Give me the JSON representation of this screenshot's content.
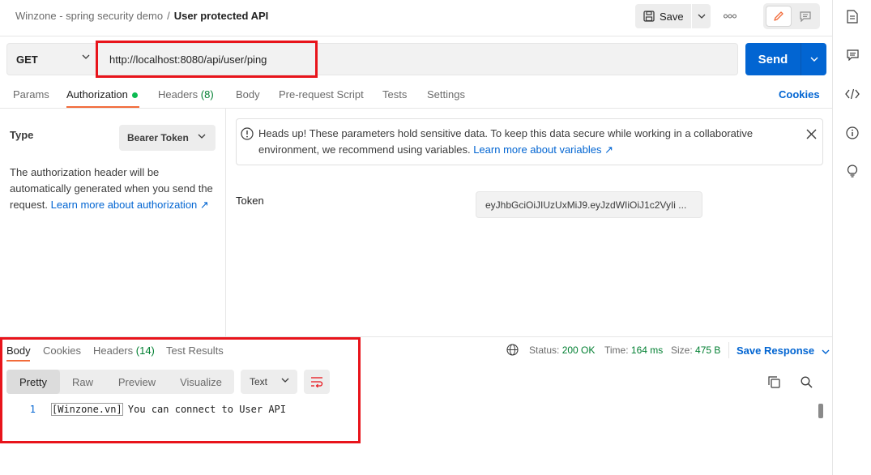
{
  "breadcrumb": {
    "workspace": "Winzone - spring security demo",
    "separator": "/",
    "request_name": "User protected API"
  },
  "toolbar": {
    "save_label": "Save",
    "more_label": "ooo"
  },
  "request": {
    "method": "GET",
    "url": "http://localhost:8080/api/user/ping",
    "send_label": "Send"
  },
  "request_tabs": [
    {
      "label": "Params"
    },
    {
      "label": "Authorization",
      "active": true,
      "indicator": "green-dot"
    },
    {
      "label": "Headers",
      "count": "(8)"
    },
    {
      "label": "Body"
    },
    {
      "label": "Pre-request Script"
    },
    {
      "label": "Tests"
    },
    {
      "label": "Settings"
    }
  ],
  "cookies_link": "Cookies",
  "auth": {
    "type_label": "Type",
    "type_value": "Bearer Token",
    "help_text": "The authorization header will be automatically generated when you send the request.",
    "help_link": "Learn more about authorization ↗",
    "banner_text": "Heads up! These parameters hold sensitive data. To keep this data secure while working in a collaborative environment, we recommend using variables.",
    "banner_link": "Learn more about variables ↗",
    "token_label": "Token",
    "token_value": "eyJhbGciOiJIUzUxMiJ9.eyJzdWIiOiJ1c2VyIi ..."
  },
  "response": {
    "tabs": [
      {
        "label": "Body",
        "active": true
      },
      {
        "label": "Cookies"
      },
      {
        "label": "Headers",
        "count": "(14)"
      },
      {
        "label": "Test Results"
      }
    ],
    "status_label": "Status:",
    "status_value": "200 OK",
    "time_label": "Time:",
    "time_value": "164 ms",
    "size_label": "Size:",
    "size_value": "475 B",
    "save_response": "Save Response",
    "views": [
      "Pretty",
      "Raw",
      "Preview",
      "Visualize"
    ],
    "active_view": "Pretty",
    "format": "Text",
    "line_number": "1",
    "body_bracket": "[Winzone.vn]",
    "body_text": " You can connect to User API"
  },
  "icons": {
    "rail": [
      "document-icon",
      "comment-icon",
      "code-icon",
      "info-icon",
      "lightbulb-icon"
    ]
  },
  "colors": {
    "accent": "#0265d2",
    "tab_active": "#f26b3a",
    "success": "#007f31",
    "annotation": "#e8141b"
  }
}
